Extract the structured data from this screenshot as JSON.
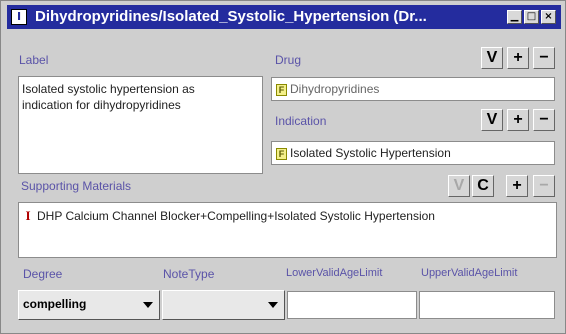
{
  "window": {
    "title": "Dihydropyridines/Isolated_Systolic_Hypertension (Dr...",
    "icon_label": "I",
    "controls": {
      "minimize": "▁",
      "maximize": "□",
      "close": "×"
    }
  },
  "label_section": {
    "label": "Label",
    "text_line1": "Isolated systolic hypertension as",
    "text_line2": "indication for dihydropyridines"
  },
  "drug_section": {
    "label": "Drug",
    "value": "Dihydropyridines",
    "icon": "F",
    "buttons": {
      "view": "V",
      "add": "+",
      "remove": "−"
    }
  },
  "indication_section": {
    "label": "Indication",
    "value": "Isolated Systolic Hypertension",
    "icon": "F",
    "buttons": {
      "view": "V",
      "add": "+",
      "remove": "−"
    }
  },
  "supporting_section": {
    "label": "Supporting Materials",
    "item": "DHP Calcium Channel Blocker+Compelling+Isolated Systolic Hypertension",
    "item_icon": "I",
    "buttons": {
      "view": "V",
      "create": "C",
      "add": "+",
      "remove": "−"
    }
  },
  "bottom_fields": {
    "degree_label": "Degree",
    "degree_value": "compelling",
    "note_type_label": "NoteType",
    "note_type_value": "",
    "lower_age_label": "LowerValidAgeLimit",
    "lower_age_value": "",
    "upper_age_label": "UpperValidAgeLimit",
    "upper_age_value": ""
  },
  "colors": {
    "titlebar": "#242c9e",
    "section_label": "#5a53a8",
    "window_bg": "#cfcfcf"
  }
}
